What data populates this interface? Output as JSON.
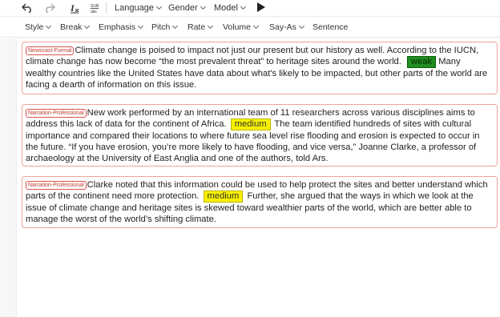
{
  "toolbar": {
    "undo_icon": "undo-icon",
    "redo_icon": "redo-icon",
    "clear_format_icon": "clear-format-icon",
    "sub_icon": "sub-alias-icon",
    "sub_icon_label": "SUB abc",
    "dropdowns": {
      "language": "Language",
      "gender": "Gender",
      "model": "Model"
    },
    "play_icon": "play-icon"
  },
  "format_toolbar": {
    "style": "Style",
    "break": "Break",
    "emphasis": "Emphasis",
    "pitch": "Pitch",
    "rate": "Rate",
    "volume": "Volume",
    "say_as": "Say-As",
    "sentence": "Sentence"
  },
  "paragraphs": [
    {
      "voice": "Newscast-Formal",
      "text_before": "Climate change is poised to impact not just our present but our history as well. According to the IUCN, climate change has now become “the most prevalent threat” to heritage sites around the world.",
      "emphasis": "weak",
      "text_after": " Many wealthy countries like the United States have data about what's likely to be impacted, but other parts of the world are facing a dearth of information on this issue."
    },
    {
      "voice": "Narration-Professional",
      "text_before": "New work performed by an international team of 11 researchers across various disciplines aims to address this lack of data for the continent of Africa.",
      "emphasis": "medium",
      "text_after": " The team identified hundreds of sites with cultural importance and compared their locations to where future sea level rise flooding and erosion is expected to occur in the future. “If you have erosion, you’re more likely to have flooding, and vice versa,” Joanne Clarke, a professor of archaeology at the University of East Anglia and one of the authors, told Ars."
    },
    {
      "voice": "Narration-Professional",
      "text_before": "Clarke noted that this information could be used to help protect the sites and better understand which parts of the continent need more protection.",
      "emphasis": "medium",
      "text_after": "  Further, she argued that the ways in which we look at the issue of climate change and heritage sites is skewed toward wealthier parts of the world, which are better able to manage the worst of the world’s shifting climate."
    }
  ]
}
